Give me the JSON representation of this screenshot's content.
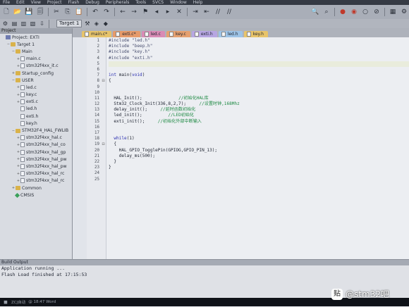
{
  "menu": [
    "File",
    "Edit",
    "View",
    "Project",
    "Flash",
    "Debug",
    "Peripherals",
    "Tools",
    "SVCS",
    "Window",
    "Help"
  ],
  "toolbar": {
    "target": "Target 1"
  },
  "project": {
    "title": "Project",
    "tree": [
      {
        "level": 0,
        "toggle": "",
        "icon": "proj",
        "label": "Project: EXTI"
      },
      {
        "level": 1,
        "toggle": "−",
        "icon": "folder",
        "label": "Target 1"
      },
      {
        "level": 2,
        "toggle": "−",
        "icon": "folder",
        "label": "Main"
      },
      {
        "level": 3,
        "toggle": "+",
        "icon": "file",
        "label": "main.c"
      },
      {
        "level": 3,
        "toggle": "+",
        "icon": "file",
        "label": "stm32f4xx_it.c"
      },
      {
        "level": 2,
        "toggle": "+",
        "icon": "folder",
        "label": "Startup_config"
      },
      {
        "level": 2,
        "toggle": "−",
        "icon": "folder",
        "label": "USER"
      },
      {
        "level": 3,
        "toggle": "+",
        "icon": "file",
        "label": "led.c"
      },
      {
        "level": 3,
        "toggle": "+",
        "icon": "file",
        "label": "key.c"
      },
      {
        "level": 3,
        "toggle": "+",
        "icon": "file",
        "label": "exti.c"
      },
      {
        "level": 3,
        "toggle": "",
        "icon": "file",
        "label": "led.h"
      },
      {
        "level": 3,
        "toggle": "",
        "icon": "file",
        "label": "exti.h"
      },
      {
        "level": 3,
        "toggle": "",
        "icon": "file",
        "label": "key.h"
      },
      {
        "level": 2,
        "toggle": "−",
        "icon": "folder",
        "label": "STM32F4_HAL_FWLIB"
      },
      {
        "level": 3,
        "toggle": "+",
        "icon": "file",
        "label": "stm32f4xx_hal.c"
      },
      {
        "level": 3,
        "toggle": "+",
        "icon": "file",
        "label": "stm32f4xx_hal_co"
      },
      {
        "level": 3,
        "toggle": "+",
        "icon": "file",
        "label": "stm32f4xx_hal_gp"
      },
      {
        "level": 3,
        "toggle": "+",
        "icon": "file",
        "label": "stm32f4xx_hal_pw"
      },
      {
        "level": 3,
        "toggle": "+",
        "icon": "file",
        "label": "stm32f4xx_hal_pw"
      },
      {
        "level": 3,
        "toggle": "+",
        "icon": "file",
        "label": "stm32f4xx_hal_rc"
      },
      {
        "level": 3,
        "toggle": "+",
        "icon": "file",
        "label": "stm32f4xx_hal_rc"
      },
      {
        "level": 2,
        "toggle": "+",
        "icon": "folder",
        "label": "Common"
      },
      {
        "level": 2,
        "toggle": "",
        "icon": "gem",
        "label": "CMSIS"
      }
    ]
  },
  "tabs": [
    {
      "label": "main.c*",
      "color": "#e6c36a"
    },
    {
      "label": "exti.c*",
      "color": "#e69a6a"
    },
    {
      "label": "led.c",
      "color": "#d98bb5"
    },
    {
      "label": "key.c",
      "color": "#e5a070"
    },
    {
      "label": "exti.h",
      "color": "#b7a6e2"
    },
    {
      "label": "led.h",
      "color": "#9dc3e6"
    },
    {
      "label": "key.h",
      "color": "#e8c46a"
    }
  ],
  "code": [
    {
      "n": "1",
      "f": "",
      "segs": [
        {
          "t": "#include \"led.h\"",
          "c": "pp"
        }
      ]
    },
    {
      "n": "2",
      "f": "",
      "segs": [
        {
          "t": "#include \"beep.h\"",
          "c": "pp"
        }
      ]
    },
    {
      "n": "3",
      "f": "",
      "segs": [
        {
          "t": "#include \"key.h\"",
          "c": "pp"
        }
      ]
    },
    {
      "n": "4",
      "f": "",
      "segs": [
        {
          "t": "#include \"exti.h\"",
          "c": "pp"
        }
      ]
    },
    {
      "n": "5",
      "f": "",
      "cur": true,
      "segs": []
    },
    {
      "n": "6",
      "f": "",
      "segs": []
    },
    {
      "n": "7",
      "f": "",
      "segs": [
        {
          "t": "int ",
          "c": "kw"
        },
        {
          "t": "main(",
          "c": "fn"
        },
        {
          "t": "void",
          "c": "kw"
        },
        {
          "t": ")",
          "c": "fn"
        }
      ]
    },
    {
      "n": "8",
      "f": "⊟",
      "segs": [
        {
          "t": "{",
          "c": "fn"
        }
      ]
    },
    {
      "n": "9",
      "f": "",
      "segs": []
    },
    {
      "n": "10",
      "f": "",
      "segs": []
    },
    {
      "n": "11",
      "f": "",
      "segs": [
        {
          "t": "  HAL_Init();              ",
          "c": "fn"
        },
        {
          "t": "//初始化HAL库",
          "c": "cm"
        }
      ]
    },
    {
      "n": "12",
      "f": "",
      "segs": [
        {
          "t": "  Stm32_Clock_Init(336,8,2,7);     ",
          "c": "fn"
        },
        {
          "t": "//设置时钟,168Mhz",
          "c": "cm"
        }
      ]
    },
    {
      "n": "13",
      "f": "",
      "segs": [
        {
          "t": "  delay_init();     ",
          "c": "fn"
        },
        {
          "t": "//延时函数初始化",
          "c": "cm"
        }
      ]
    },
    {
      "n": "14",
      "f": "",
      "segs": [
        {
          "t": "  led_init();          ",
          "c": "fn"
        },
        {
          "t": "//LED初始化",
          "c": "cm"
        }
      ]
    },
    {
      "n": "15",
      "f": "",
      "segs": [
        {
          "t": "  exti_init();     ",
          "c": "fn"
        },
        {
          "t": "//初始化外部中断输入",
          "c": "cm"
        }
      ]
    },
    {
      "n": "16",
      "f": "",
      "segs": []
    },
    {
      "n": "17",
      "f": "",
      "segs": []
    },
    {
      "n": "18",
      "f": "",
      "segs": [
        {
          "t": "  ",
          "c": "fn"
        },
        {
          "t": "while",
          "c": "kw"
        },
        {
          "t": "(1)",
          "c": "fn"
        }
      ]
    },
    {
      "n": "19",
      "f": "⊟",
      "segs": [
        {
          "t": "  {",
          "c": "fn"
        }
      ]
    },
    {
      "n": "20",
      "f": "",
      "segs": [
        {
          "t": "    HAL_GPIO_TogglePin(GPIOG,GPIO_PIN_13);",
          "c": "fn"
        }
      ]
    },
    {
      "n": "21",
      "f": "",
      "segs": [
        {
          "t": "    delay_ms(500);",
          "c": "fn"
        }
      ]
    },
    {
      "n": "22",
      "f": "",
      "segs": [
        {
          "t": "  }",
          "c": "fn"
        }
      ]
    },
    {
      "n": "23",
      "f": "",
      "segs": [
        {
          "t": "}",
          "c": "fn"
        }
      ]
    },
    {
      "n": "24",
      "f": "",
      "segs": []
    },
    {
      "n": "25",
      "f": "",
      "segs": []
    }
  ],
  "output": {
    "title": "Build Output",
    "lines": [
      "Application running ...",
      "Flash Load finished at 17:15:53"
    ]
  },
  "taskbar": {
    "items": [
      "ZCJ自动",
      "@ 18:47 Word"
    ]
  },
  "watermark": {
    "text": "@stm32吧",
    "logo_glyph": "贴"
  }
}
